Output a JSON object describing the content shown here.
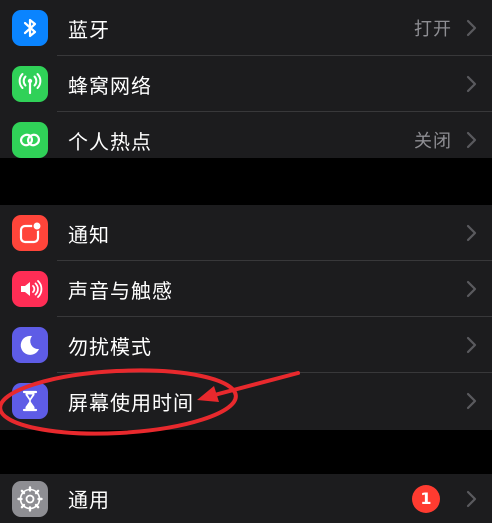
{
  "colors": {
    "background": "#000000",
    "group_background": "#1c1c1e",
    "separator": "#38383a",
    "label": "#ffffff",
    "secondary_text": "#8e8e93",
    "annotation": "#e8292d",
    "badge": "#ff3b30"
  },
  "group1": {
    "bluetooth": {
      "label": "蓝牙",
      "value": "打开",
      "icon": "bluetooth-icon",
      "icon_color": "#0a84ff"
    },
    "cellular": {
      "label": "蜂窝网络",
      "icon": "cellular-antenna-icon",
      "icon_color": "#30d158"
    },
    "hotspot": {
      "label": "个人热点",
      "value": "关闭",
      "icon": "personal-hotspot-icon",
      "icon_color": "#30d158"
    }
  },
  "group2": {
    "notifications": {
      "label": "通知",
      "icon": "notifications-icon",
      "icon_color": "#ff453a"
    },
    "sounds": {
      "label": "声音与触感",
      "icon": "speaker-icon",
      "icon_color": "#ff2d55"
    },
    "dnd": {
      "label": "勿扰模式",
      "icon": "moon-icon",
      "icon_color": "#5e5ce6"
    },
    "screen_time": {
      "label": "屏幕使用时间",
      "icon": "hourglass-icon",
      "icon_color": "#5e5ce6"
    }
  },
  "group3": {
    "general": {
      "label": "通用",
      "badge": "1",
      "icon": "gear-icon",
      "icon_color": "#8e8e93"
    }
  }
}
